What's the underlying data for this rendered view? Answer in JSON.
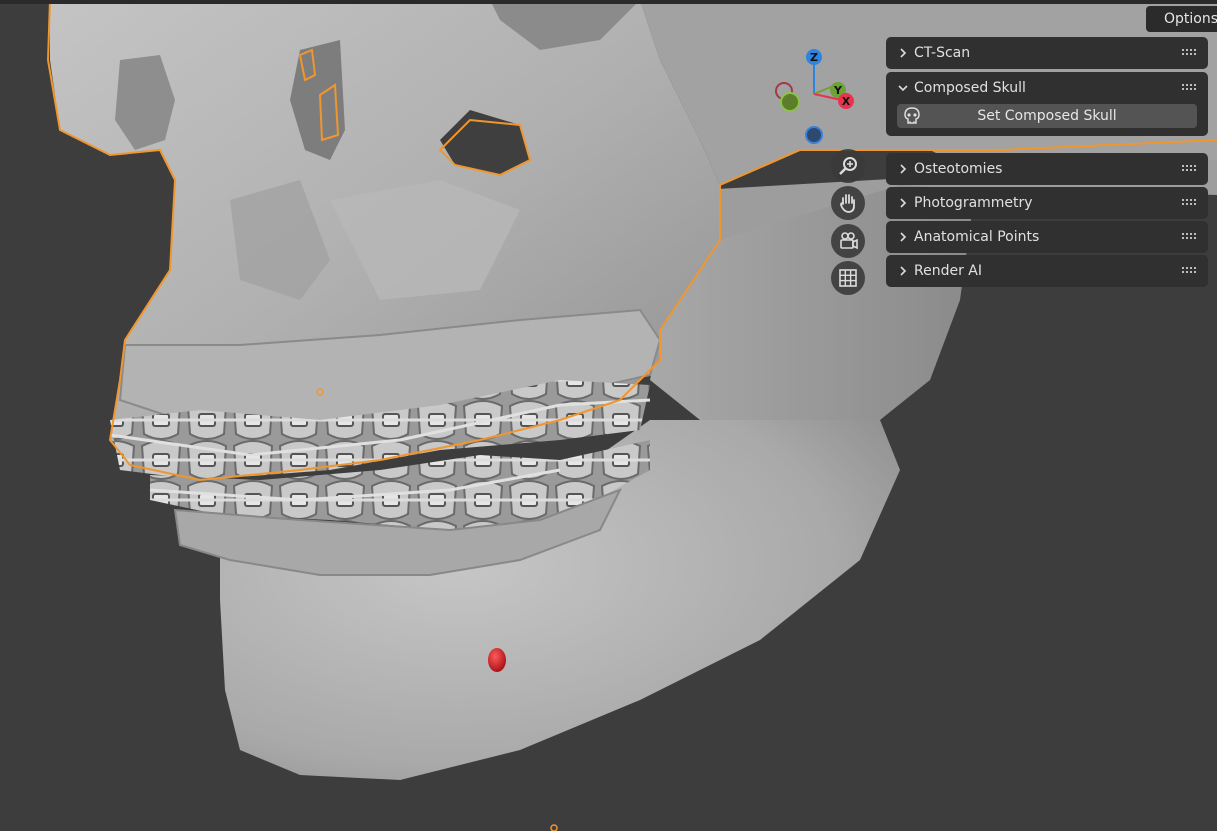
{
  "header": {
    "options_label": "Options"
  },
  "gizmo": {
    "z_label": "Z",
    "y_label": "Y",
    "x_label": "X"
  },
  "nav_buttons": [
    {
      "icon": "zoom-icon"
    },
    {
      "icon": "pan-hand-icon"
    },
    {
      "icon": "camera-icon"
    },
    {
      "icon": "grid-icon"
    }
  ],
  "panels": [
    {
      "label": "CT-Scan",
      "expanded": false
    },
    {
      "label": "Composed Skull",
      "expanded": true,
      "button_label": "Set Composed Skull",
      "button_icon": "skull-icon"
    },
    {
      "label": "Osteotomies",
      "expanded": false
    },
    {
      "label": "Photogrammetry",
      "expanded": false
    },
    {
      "label": "Anatomical Points",
      "expanded": false
    },
    {
      "label": "Render AI",
      "expanded": false
    }
  ],
  "colors": {
    "background": "#3d3d3d",
    "panel": "#303030",
    "button": "#545454",
    "selection_outline": "#f0962e",
    "axis_x": "#e8334f",
    "axis_y": "#6ea136",
    "axis_z": "#2f84e0",
    "landmark": "#c8141c"
  }
}
